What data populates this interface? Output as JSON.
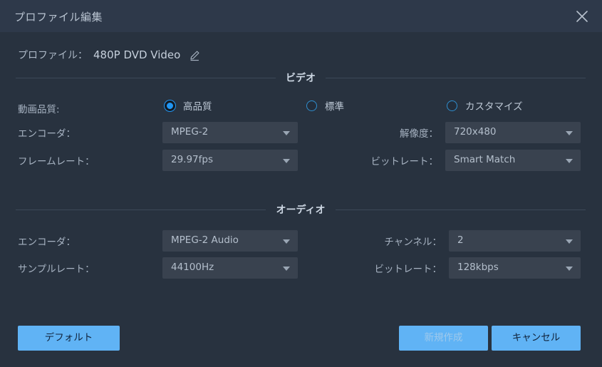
{
  "window": {
    "title": "プロファイル編集",
    "close_icon": "close-icon"
  },
  "profile": {
    "label": "プロファイル：",
    "value": "480P DVD Video",
    "edit_icon": "pencil-edit-icon"
  },
  "sections": {
    "video": {
      "title": "ビデオ",
      "quality": {
        "label": "動画品質:",
        "options": [
          {
            "label": "高品質",
            "selected": true
          },
          {
            "label": "標準",
            "selected": false
          },
          {
            "label": "カスタマイズ",
            "selected": false
          }
        ]
      },
      "fields": [
        {
          "label": "エンコーダ：",
          "value": "MPEG-2"
        },
        {
          "label": "フレームレート：",
          "value": "29.97fps"
        },
        {
          "label": "解像度：",
          "value": "720x480"
        },
        {
          "label": "ビットレート：",
          "value": "Smart Match"
        }
      ]
    },
    "audio": {
      "title": "オーディオ",
      "fields": [
        {
          "label": "エンコーダ：",
          "value": "MPEG-2 Audio"
        },
        {
          "label": "サンプルレート：",
          "value": "44100Hz"
        },
        {
          "label": "チャンネル：",
          "value": "2"
        },
        {
          "label": "ビットレート：",
          "value": "128kbps"
        }
      ]
    }
  },
  "footer": {
    "default_label": "デフォルト",
    "create_label": "新規作成",
    "cancel_label": "キャンセル"
  },
  "colors": {
    "window_bg": "#28323f",
    "titlebar_bg": "#2e394a",
    "select_bg": "#39424f",
    "accent": "#60b3f5",
    "radio_on": "#2196f3",
    "divider": "#3c4858"
  }
}
